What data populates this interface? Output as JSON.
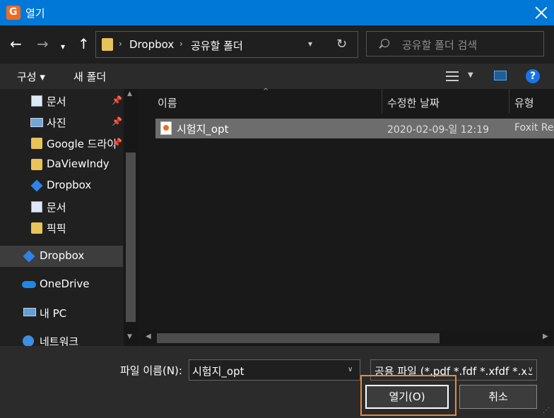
{
  "window": {
    "title": "열기",
    "app_icon_letter": "G"
  },
  "nav": {
    "back": "←",
    "forward": "→",
    "recent": "▾",
    "up": "↑",
    "breadcrumbs": [
      "Dropbox",
      "공유할 폴더"
    ],
    "crumb_separator": "›",
    "refresh": "↻",
    "search_placeholder": "공유할 폴더 검색"
  },
  "toolbar": {
    "organize": "구성 ▾",
    "new_folder": "새 폴더",
    "help": "?"
  },
  "sidebar": {
    "items": [
      {
        "label": "문서",
        "icon": "document-icon",
        "pinned": true
      },
      {
        "label": "사진",
        "icon": "pictures-icon",
        "pinned": true
      },
      {
        "label": "Google 드라이",
        "icon": "folder-icon",
        "pinned": true
      },
      {
        "label": "DaViewIndy",
        "icon": "folder-icon",
        "pinned": false
      },
      {
        "label": "Dropbox",
        "icon": "dropbox-icon",
        "pinned": false
      },
      {
        "label": "문서",
        "icon": "document-icon",
        "pinned": false
      },
      {
        "label": "픽픽",
        "icon": "folder-icon",
        "pinned": false
      },
      {
        "label": "Dropbox",
        "icon": "dropbox-icon",
        "pinned": false,
        "selected": true
      },
      {
        "label": "OneDrive",
        "icon": "onedrive-icon",
        "pinned": false
      },
      {
        "label": "내 PC",
        "icon": "pc-icon",
        "pinned": false
      },
      {
        "label": "네트워크",
        "icon": "network-icon",
        "pinned": false
      }
    ],
    "pin_glyph": "📌"
  },
  "filelist": {
    "columns": [
      "이름",
      "수정한 날짜",
      "유형"
    ],
    "sort_glyph": "^",
    "rows": [
      {
        "name": "시험지_opt",
        "modified": "2020-02-09-일 12:19",
        "type": "Foxit Re"
      }
    ]
  },
  "footer": {
    "filename_label": "파일 이름(N):",
    "filename_value": "시험지_opt",
    "filter_value": "공용 파일 (*.pdf *.fdf *.xfdf *.xc",
    "open_label": "열기(O)",
    "cancel_label": "취소"
  },
  "colors": {
    "titlebar": "#0078d7",
    "highlight": "#e88a3c",
    "accent": "#f06a22"
  }
}
